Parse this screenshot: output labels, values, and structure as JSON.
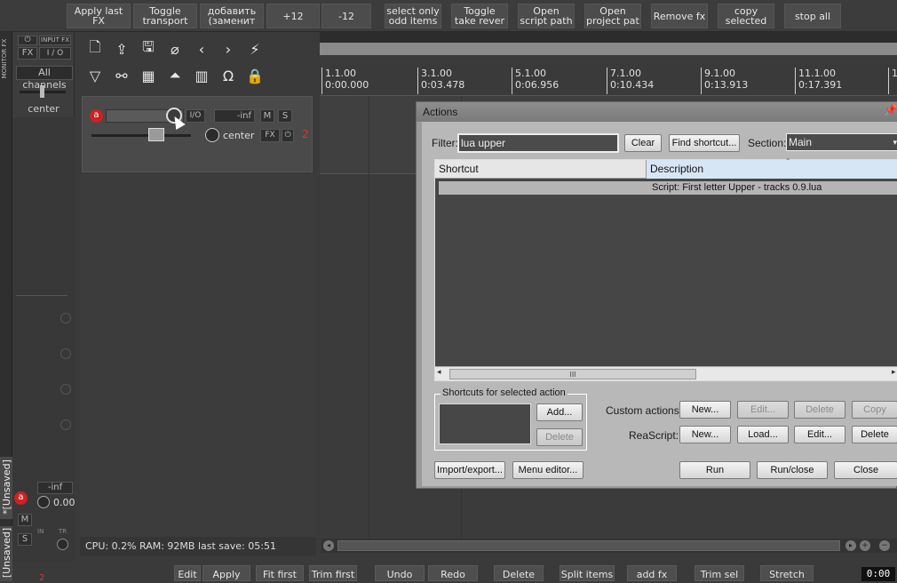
{
  "top_toolbar": {
    "buttons": [
      {
        "label": "Apply last\nFX"
      },
      {
        "label": "Toggle\ntransport"
      },
      {
        "label": "добавить\n(заменит"
      },
      {
        "label": "+12"
      },
      {
        "label": "-12"
      },
      {
        "label": "select only\nodd items"
      },
      {
        "label": "Toggle\ntake rever"
      },
      {
        "label": "Open\nscript path"
      },
      {
        "label": "Open\nproject pat"
      },
      {
        "label": "Remove fx"
      },
      {
        "label": "copy\nselected"
      },
      {
        "label": "stop all"
      }
    ]
  },
  "monitor": {
    "vertical_label": "MONITOR FX",
    "fx_label": "FX",
    "input_fx_label": "INPUT FX",
    "io_label": "I / O",
    "channels": "All channels",
    "pan": "center"
  },
  "track": {
    "io": "I/O",
    "volume": "-inf",
    "mute": "M",
    "solo": "S",
    "pan": "center",
    "fx": "FX",
    "number": "2",
    "arm": "a"
  },
  "master": {
    "unsaved_label_1": "*[Unsaved]",
    "unsaved_label_2": "[Unsaved]",
    "volume": "-inf",
    "gain": "0.00",
    "mute": "M",
    "solo": "S",
    "in_label": "IN",
    "tr_label": "TR",
    "arm": "a",
    "number": "2"
  },
  "status_bar": {
    "text": "CPU: 0.2%  RAM: 92MB  last save: 05:51"
  },
  "ruler": {
    "marks": [
      {
        "bar": "1.1.00",
        "time": "0:00.000"
      },
      {
        "bar": "3.1.00",
        "time": "0:03.478"
      },
      {
        "bar": "5.1.00",
        "time": "0:06.956"
      },
      {
        "bar": "7.1.00",
        "time": "0:10.434"
      },
      {
        "bar": "9.1.00",
        "time": "0:13.913"
      },
      {
        "bar": "11.1.00",
        "time": "0:17.391"
      },
      {
        "bar": "1",
        "time": ""
      }
    ]
  },
  "actions_dialog": {
    "title": "Actions",
    "filter_label": "Filter:",
    "filter_value": "lua upper",
    "clear": "Clear",
    "find_shortcut": "Find shortcut...",
    "section_label": "Section:",
    "section_value": "Main",
    "col_shortcut": "Shortcut",
    "col_description": "Description",
    "rows": [
      {
        "shortcut": "",
        "description": "Script: First letter Upper - tracks 0.9.lua"
      }
    ],
    "shortcuts_group": "Shortcuts for selected action",
    "add": "Add...",
    "delete": "Delete",
    "custom_actions_label": "Custom actions:",
    "custom_new": "New...",
    "custom_edit": "Edit...",
    "custom_delete": "Delete",
    "custom_copy": "Copy",
    "reascript_label": "ReaScript:",
    "rs_new": "New...",
    "rs_load": "Load...",
    "rs_edit": "Edit...",
    "rs_delete": "Delete",
    "import_export": "Import/export...",
    "menu_editor": "Menu editor...",
    "run": "Run",
    "run_close": "Run/close",
    "close": "Close",
    "scroll_grip": "III"
  },
  "bottom_toolbar": {
    "buttons": [
      {
        "label": "Edit"
      },
      {
        "label": "Apply last"
      },
      {
        "label": "Fit first"
      },
      {
        "label": "Trim first"
      },
      {
        "label": "Undo"
      },
      {
        "label": "Redo"
      },
      {
        "label": "Delete"
      },
      {
        "label": "Split items"
      },
      {
        "label": "add fx"
      },
      {
        "label": "Trim sel"
      },
      {
        "label": "Stretch"
      }
    ]
  },
  "time_display": "0:00"
}
